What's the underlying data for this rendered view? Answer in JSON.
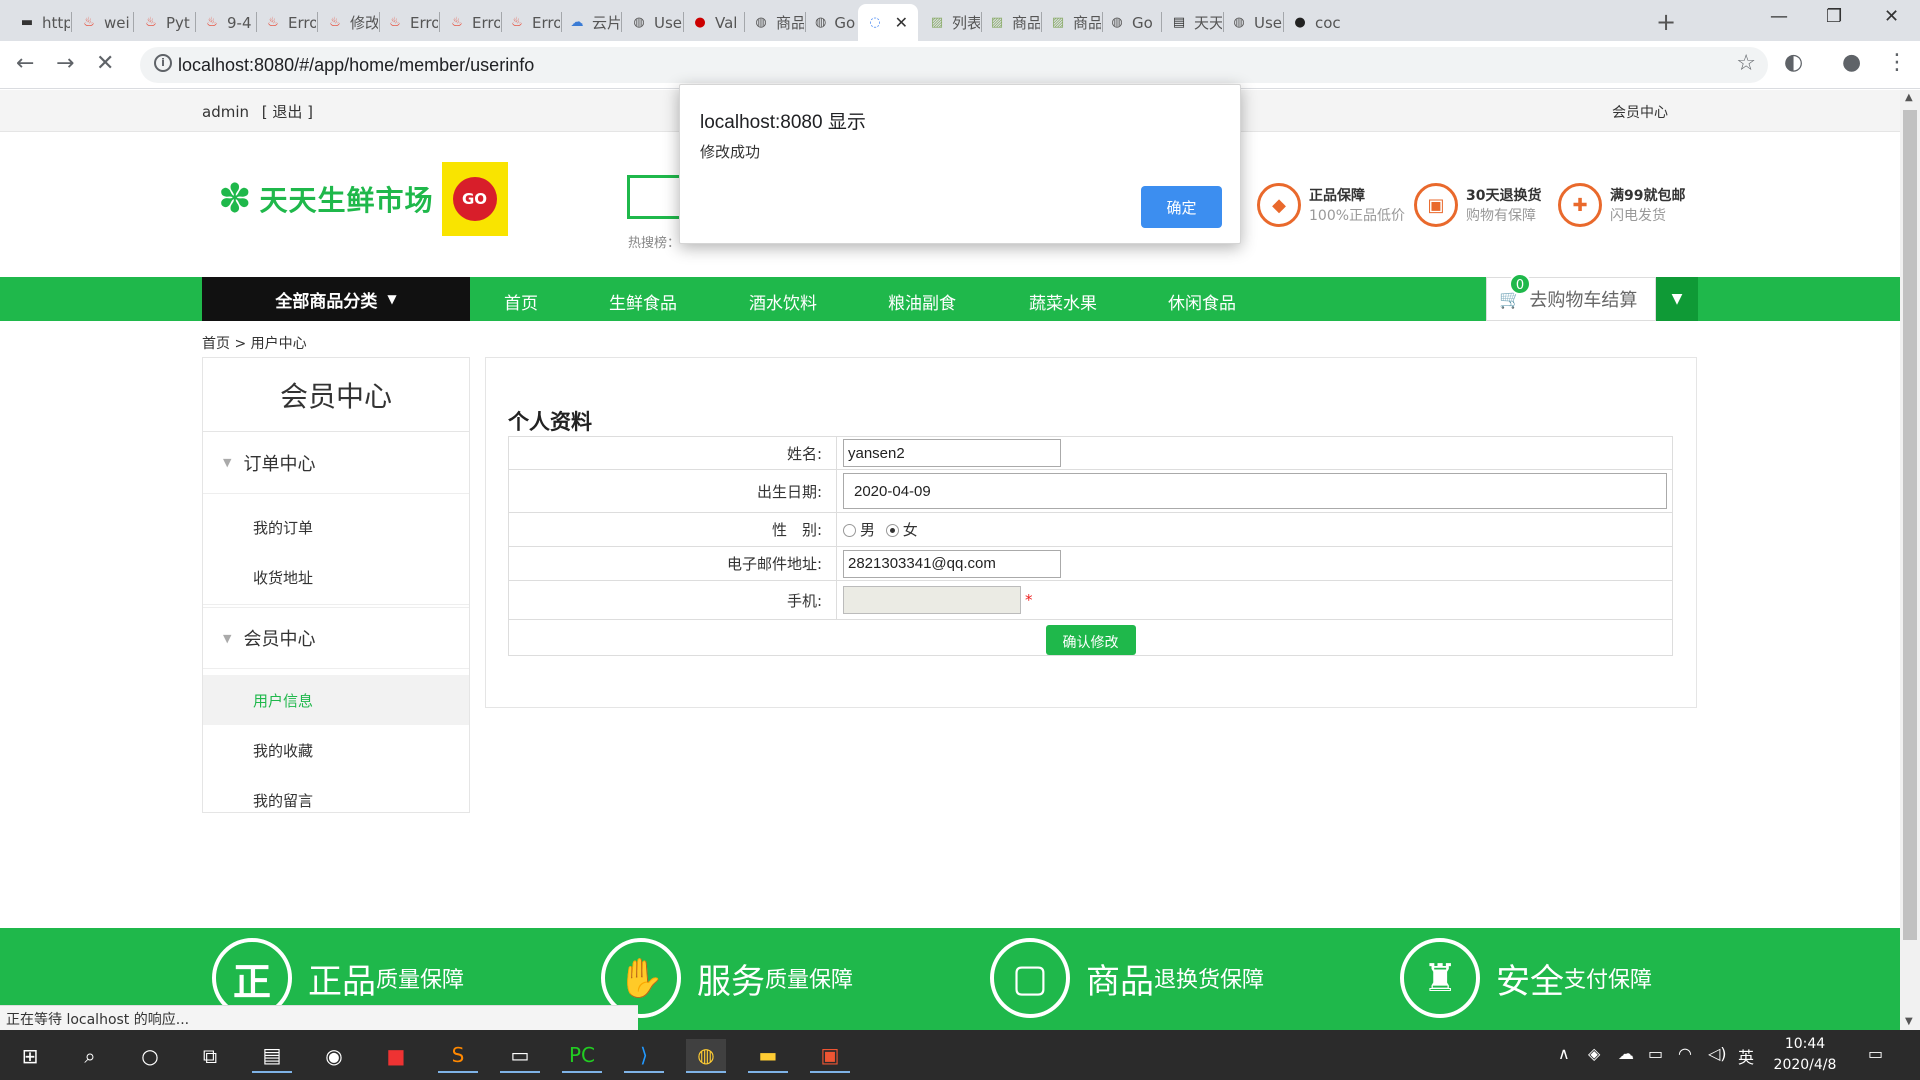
{
  "browser": {
    "tabs": [
      {
        "label": "http",
        "icon": "book-icon"
      },
      {
        "label": "wei",
        "icon": "flame-icon"
      },
      {
        "label": "Pyt",
        "icon": "flame-icon"
      },
      {
        "label": "9-4",
        "icon": "flame-icon"
      },
      {
        "label": "Erro",
        "icon": "flame-icon"
      },
      {
        "label": "修改",
        "icon": "flame-icon"
      },
      {
        "label": "Erro",
        "icon": "flame-icon"
      },
      {
        "label": "Erro",
        "icon": "flame-icon"
      },
      {
        "label": "Erro",
        "icon": "flame-icon"
      },
      {
        "label": "云片",
        "icon": "cloud-icon"
      },
      {
        "label": "Use",
        "icon": "globe-icon"
      },
      {
        "label": "Val",
        "icon": "dot-icon"
      },
      {
        "label": "商品",
        "icon": "globe-icon"
      },
      {
        "label": "Go",
        "icon": "globe-icon"
      },
      {
        "label": "",
        "icon": "loading-icon",
        "active": true
      },
      {
        "label": "列表",
        "icon": "image-icon"
      },
      {
        "label": "商品",
        "icon": "image-icon"
      },
      {
        "label": "商品",
        "icon": "image-icon"
      },
      {
        "label": "Go",
        "icon": "globe-icon"
      },
      {
        "label": "天天",
        "icon": "page-icon"
      },
      {
        "label": "Use",
        "icon": "globe-icon"
      },
      {
        "label": "coc",
        "icon": "circle-icon"
      }
    ],
    "url": "localhost:8080/#/app/home/member/userinfo",
    "status": "正在等待 localhost 的响应..."
  },
  "header": {
    "user": "admin",
    "logout": "[ 退出 ]",
    "member_center": "会员中心",
    "logo_text": "天天生鲜市场",
    "logo_badge": "GO",
    "hot_search_label": "热搜榜：",
    "guarantees": [
      {
        "title": "正品保障",
        "sub": "100%正品低价",
        "icon": "diamond-icon"
      },
      {
        "title": "30天退换货",
        "sub": "购物有保障",
        "icon": "box-icon"
      },
      {
        "title": "满99就包邮",
        "sub": "闪电发货",
        "icon": "gift-icon"
      }
    ]
  },
  "nav": {
    "all_categories": "全部商品分类",
    "items": [
      "首页",
      "生鲜食品",
      "酒水饮料",
      "粮油副食",
      "蔬菜水果",
      "休闲食品"
    ],
    "cart_label": "去购物车结算",
    "cart_count": "0"
  },
  "breadcrumb": {
    "home": "首页",
    "sep": ">",
    "current": "用户中心"
  },
  "sidebar": {
    "title": "会员中心",
    "groups": [
      {
        "label": "订单中心",
        "items": [
          "我的订单",
          "收货地址"
        ]
      },
      {
        "label": "会员中心",
        "items": [
          "用户信息",
          "我的收藏",
          "我的留言"
        ]
      }
    ]
  },
  "form": {
    "title": "个人资料",
    "name_label": "姓名:",
    "name_value": "yansen2",
    "birthday_label": "出生日期:",
    "birthday_value": "2020-04-09",
    "gender_label": "性　别:",
    "gender_male": "男",
    "gender_female": "女",
    "gender_selected": "女",
    "email_label": "电子邮件地址:",
    "email_value": "2821303341@qq.com",
    "phone_label": "手机:",
    "phone_value": "",
    "required_mark": "*",
    "submit_label": "确认修改"
  },
  "footer": {
    "items": [
      {
        "icon_char": "正",
        "big": "正品",
        "small": "质量保障"
      },
      {
        "icon_char": "✋",
        "big": "服务",
        "small": "质量保障"
      },
      {
        "icon_char": "▢",
        "big": "商品",
        "small": "退换货保障"
      },
      {
        "icon_char": "♜",
        "big": "安全",
        "small": "支付保障"
      }
    ]
  },
  "dialog": {
    "title": "localhost:8080 显示",
    "message": "修改成功",
    "ok": "确定"
  },
  "taskbar": {
    "ime": "英",
    "time": "10:44",
    "date": "2020/4/8"
  },
  "colors": {
    "brand_green": "#1fb84b",
    "dialog_button": "#3c8ef0",
    "guarantee_orange": "#e9692c"
  }
}
